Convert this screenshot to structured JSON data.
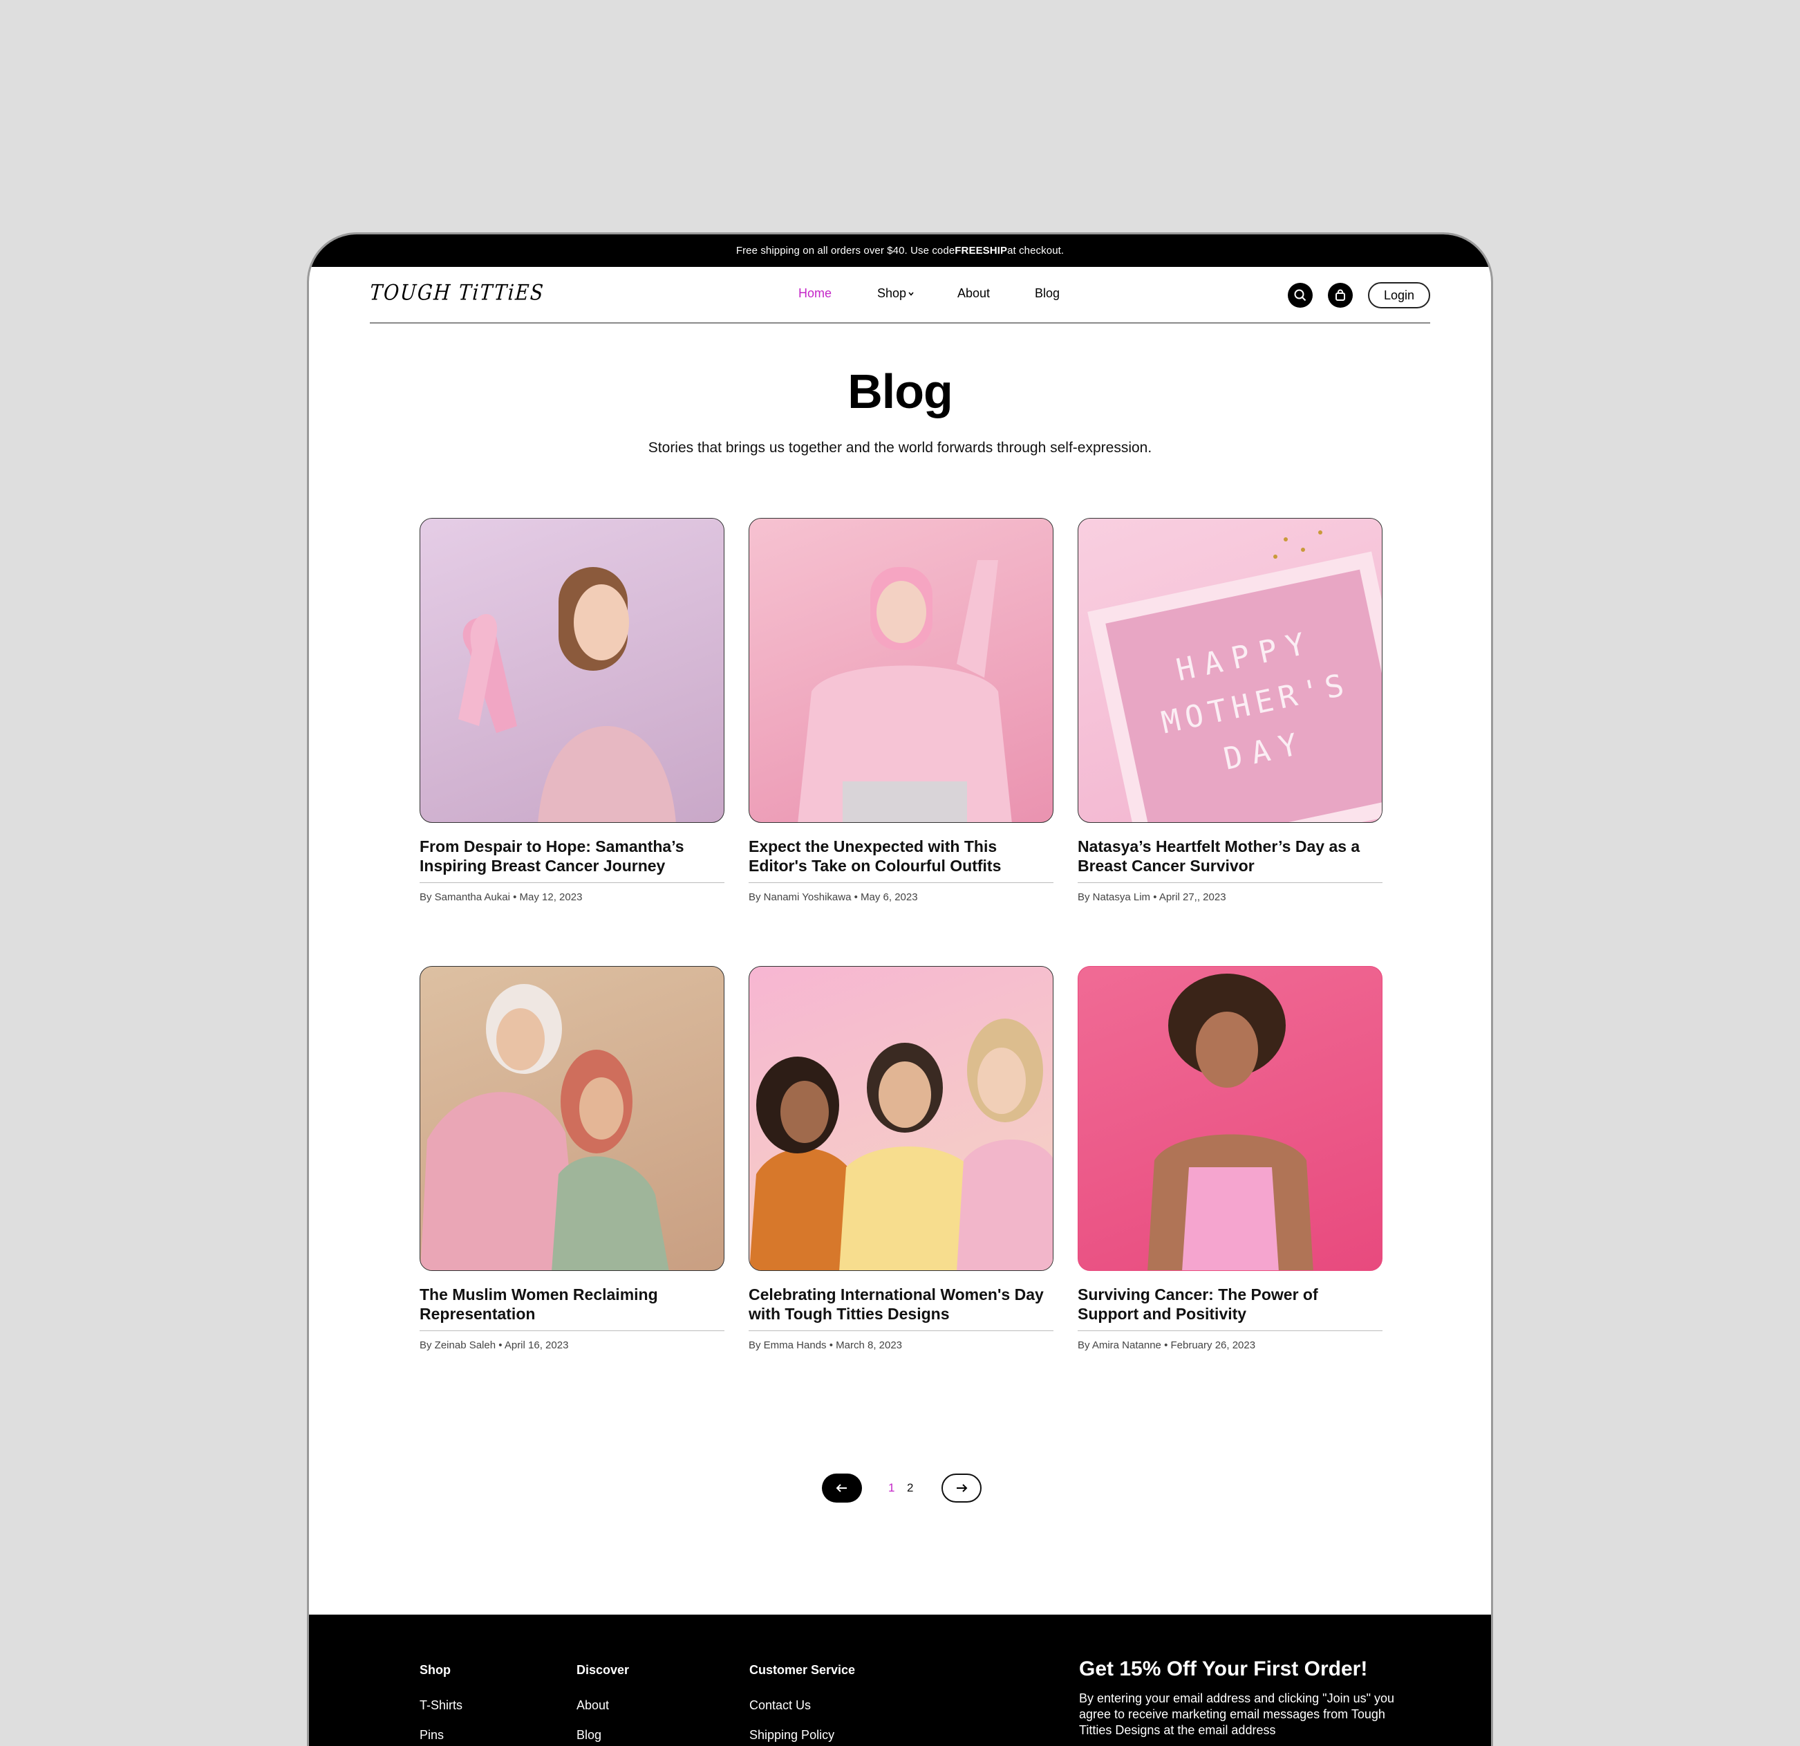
{
  "promo_bar": {
    "text_before": "Free shipping on all orders over $40. Use code ",
    "code": "FREESHIP",
    "text_after": " at checkout."
  },
  "header": {
    "logo": "TOUGH TiTTiES",
    "nav": [
      {
        "label": "Home",
        "active": true
      },
      {
        "label": "Shop",
        "has_dropdown": true
      },
      {
        "label": "About"
      },
      {
        "label": "Blog"
      }
    ],
    "icons": [
      "search-icon",
      "bag-icon"
    ],
    "login_label": "Login"
  },
  "page": {
    "title": "Blog",
    "subtitle": "Stories that brings us together and  the world forwards through self-expression."
  },
  "posts": [
    {
      "title": "From Despair to Hope: Samantha’s Inspiring Breast Cancer Journey",
      "author": "By Samantha Aukai",
      "date": "May 12, 2023"
    },
    {
      "title": "Expect the Unexpected with This Editor's Take on Colourful Outfits",
      "author": "By Nanami Yoshikawa",
      "date": "May 6, 2023"
    },
    {
      "title": "Natasya’s Heartfelt Mother’s Day as a Breast Cancer Survivor",
      "author": "By Natasya Lim",
      "date": "April 27,, 2023"
    },
    {
      "title": "The Muslim Women Reclaiming Representation",
      "author": "By Zeinab Saleh",
      "date": "April 16, 2023"
    },
    {
      "title": "Celebrating International Women's Day with Tough Titties Designs",
      "author": "By Emma Hands",
      "date": "March 8, 2023"
    },
    {
      "title": "Surviving Cancer: The Power of Support and Positivity",
      "author": "By Amira Natanne",
      "date": "February 26, 2023"
    }
  ],
  "letter_board": {
    "lines": [
      "HAPPY",
      "MOTHER'S",
      "DAY"
    ]
  },
  "pagination": {
    "pages": [
      "1",
      "2"
    ],
    "current": "1"
  },
  "footer": {
    "columns": [
      {
        "heading": "Shop",
        "links": [
          "T-Shirts",
          "Pins"
        ]
      },
      {
        "heading": "Discover",
        "links": [
          "About",
          "Blog"
        ]
      },
      {
        "heading": "Customer Service",
        "links": [
          "Contact Us",
          "Shipping Policy"
        ]
      }
    ],
    "promo_heading": "Get 15% Off Your First Order!",
    "promo_text": "By entering your email address and clicking \"Join us\" you agree to receive marketing email messages from Tough Titties Designs at the email address"
  },
  "colors": {
    "accent": "#c426c8",
    "promo_bg": "#000000",
    "footer_bg": "#000000"
  }
}
